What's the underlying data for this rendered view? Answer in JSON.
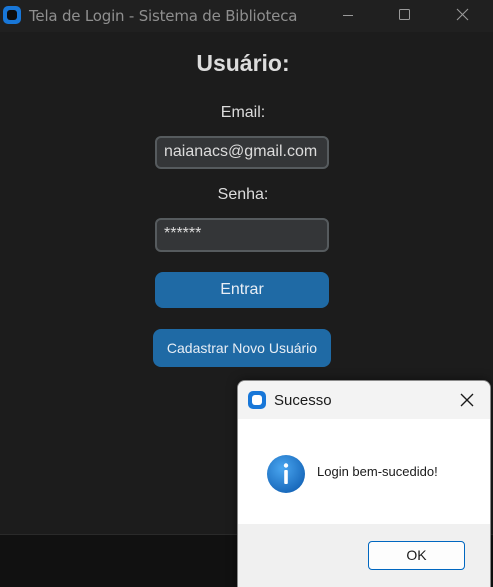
{
  "window": {
    "title": "Tela de Login - Sistema de Biblioteca"
  },
  "form": {
    "heading": "Usuário:",
    "email_label": "Email:",
    "email_value": "naianacs@gmail.com",
    "password_label": "Senha:",
    "password_value": "******",
    "login_button": "Entrar",
    "register_button": "Cadastrar Novo Usuário"
  },
  "dialog": {
    "title": "Sucesso",
    "message": "Login bem-sucedido!",
    "ok_label": "OK",
    "icon": "info-icon"
  },
  "colors": {
    "background": "#1c1c1c",
    "button": "#1f6aa5",
    "field_bg": "#343638",
    "field_border": "#565b5e",
    "accent": "#1877d8"
  }
}
